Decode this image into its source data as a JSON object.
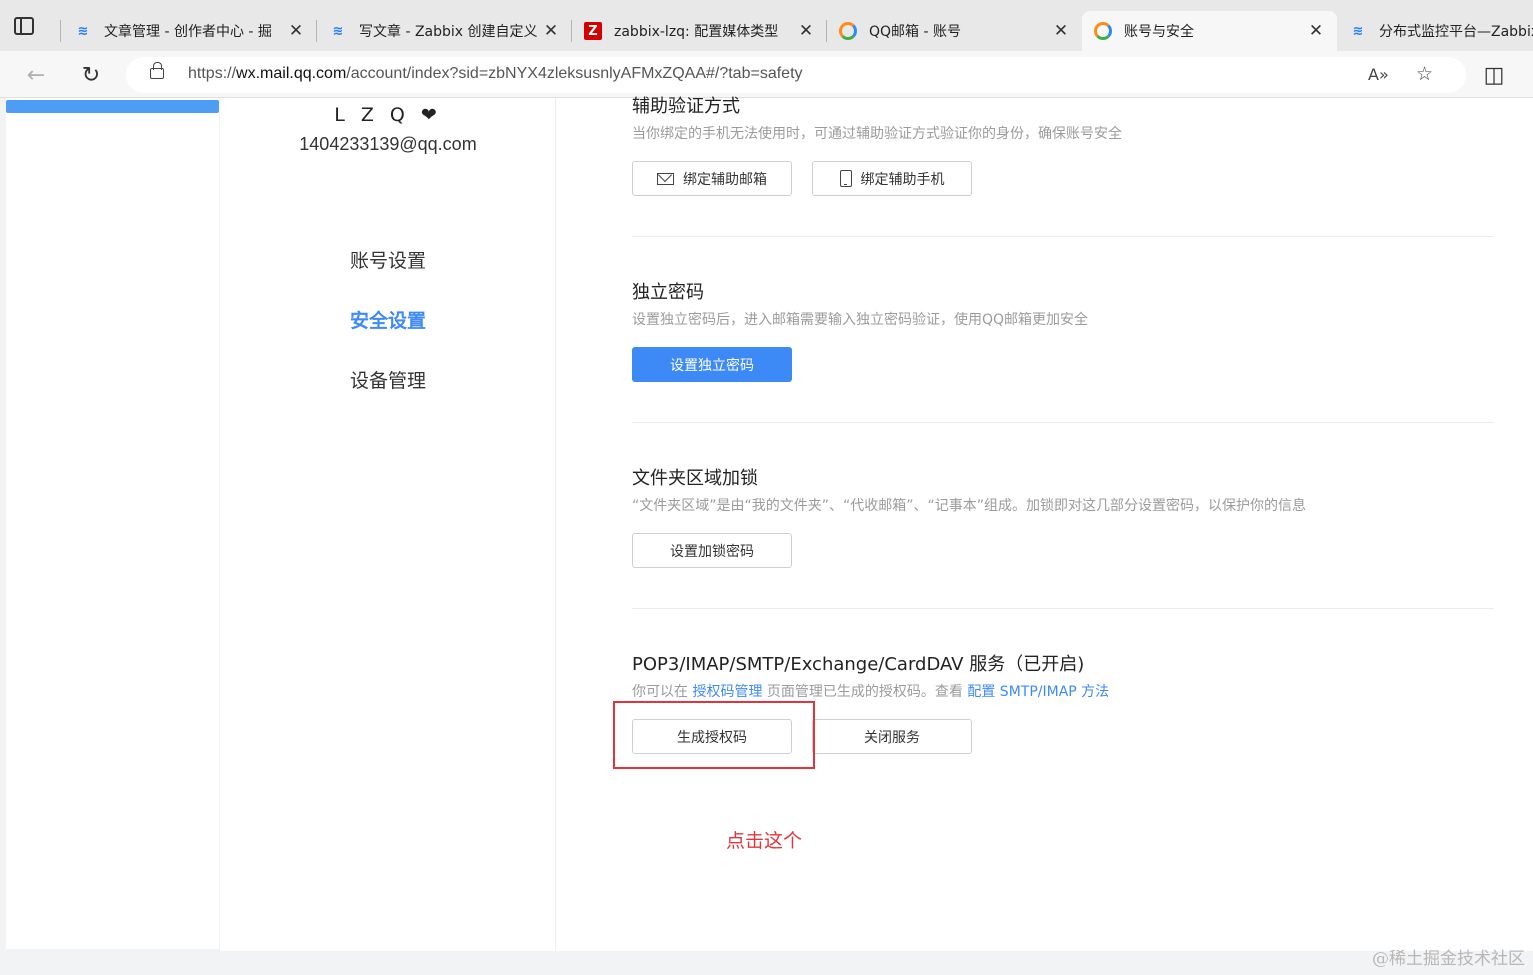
{
  "browser": {
    "tabs": [
      {
        "title": "文章管理 - 创作者中心 - 掘",
        "favicon": "juejin-icon",
        "active": false
      },
      {
        "title": "写文章 - Zabbix 创建自定义",
        "favicon": "juejin-icon",
        "active": false
      },
      {
        "title": "zabbix-lzq: 配置媒体类型",
        "favicon": "zabbix-icon",
        "active": false
      },
      {
        "title": "QQ邮箱 - 账号",
        "favicon": "qqmail-icon",
        "active": false
      },
      {
        "title": "账号与安全",
        "favicon": "qqmail-icon",
        "active": true
      },
      {
        "title": "分布式监控平台—Zabbix",
        "favicon": "juejin-icon",
        "active": false
      }
    ],
    "zabbix_glyph": "Z",
    "juejin_glyph": "≋",
    "close_glyph": "✕",
    "url_prefix": "https://",
    "url_host": "wx.mail.qq.com",
    "url_rest": "/account/index?sid=zbNYX4zleksusnlyAFMxZQAA#/?tab=safety",
    "icons": {
      "back": "←",
      "reload": "↻",
      "read_aloud": "A»",
      "favorite": "☆",
      "split": "◫"
    }
  },
  "profile": {
    "name": "L Z Q",
    "heart": "❤",
    "email": "1404233139@qq.com"
  },
  "sidenav": {
    "items": [
      {
        "label": "账号设置",
        "active": false
      },
      {
        "label": "安全设置",
        "active": true
      },
      {
        "label": "设备管理",
        "active": false
      }
    ]
  },
  "sections": {
    "aux_verify": {
      "title": "辅助验证方式",
      "desc": "当你绑定的手机无法使用时，可通过辅助验证方式验证你的身份，确保账号安全",
      "btn_email": "绑定辅助邮箱",
      "btn_phone": "绑定辅助手机"
    },
    "independent_password": {
      "title": "独立密码",
      "desc": "设置独立密码后，进入邮箱需要输入独立密码验证，使用QQ邮箱更加安全",
      "btn": "设置独立密码"
    },
    "folder_lock": {
      "title": "文件夹区域加锁",
      "desc": "“文件夹区域”是由“我的文件夹”、“代收邮箱”、“记事本”组成。加锁即对这几部分设置密码，以保护你的信息",
      "btn": "设置加锁密码"
    },
    "services": {
      "title": "POP3/IMAP/SMTP/Exchange/CardDAV 服务（已开启)",
      "desc_prefix": "你可以在",
      "desc_link1": "授权码管理",
      "desc_middle": "页面管理已生成的授权码。查看",
      "desc_link2": "配置 SMTP/IMAP 方法",
      "btn_generate": "生成授权码",
      "btn_close": "关闭服务"
    }
  },
  "annotation": "点击这个",
  "watermark": "@稀土掘金技术社区",
  "colors": {
    "accent": "#3d8af7",
    "highlight": "#e0353a"
  }
}
